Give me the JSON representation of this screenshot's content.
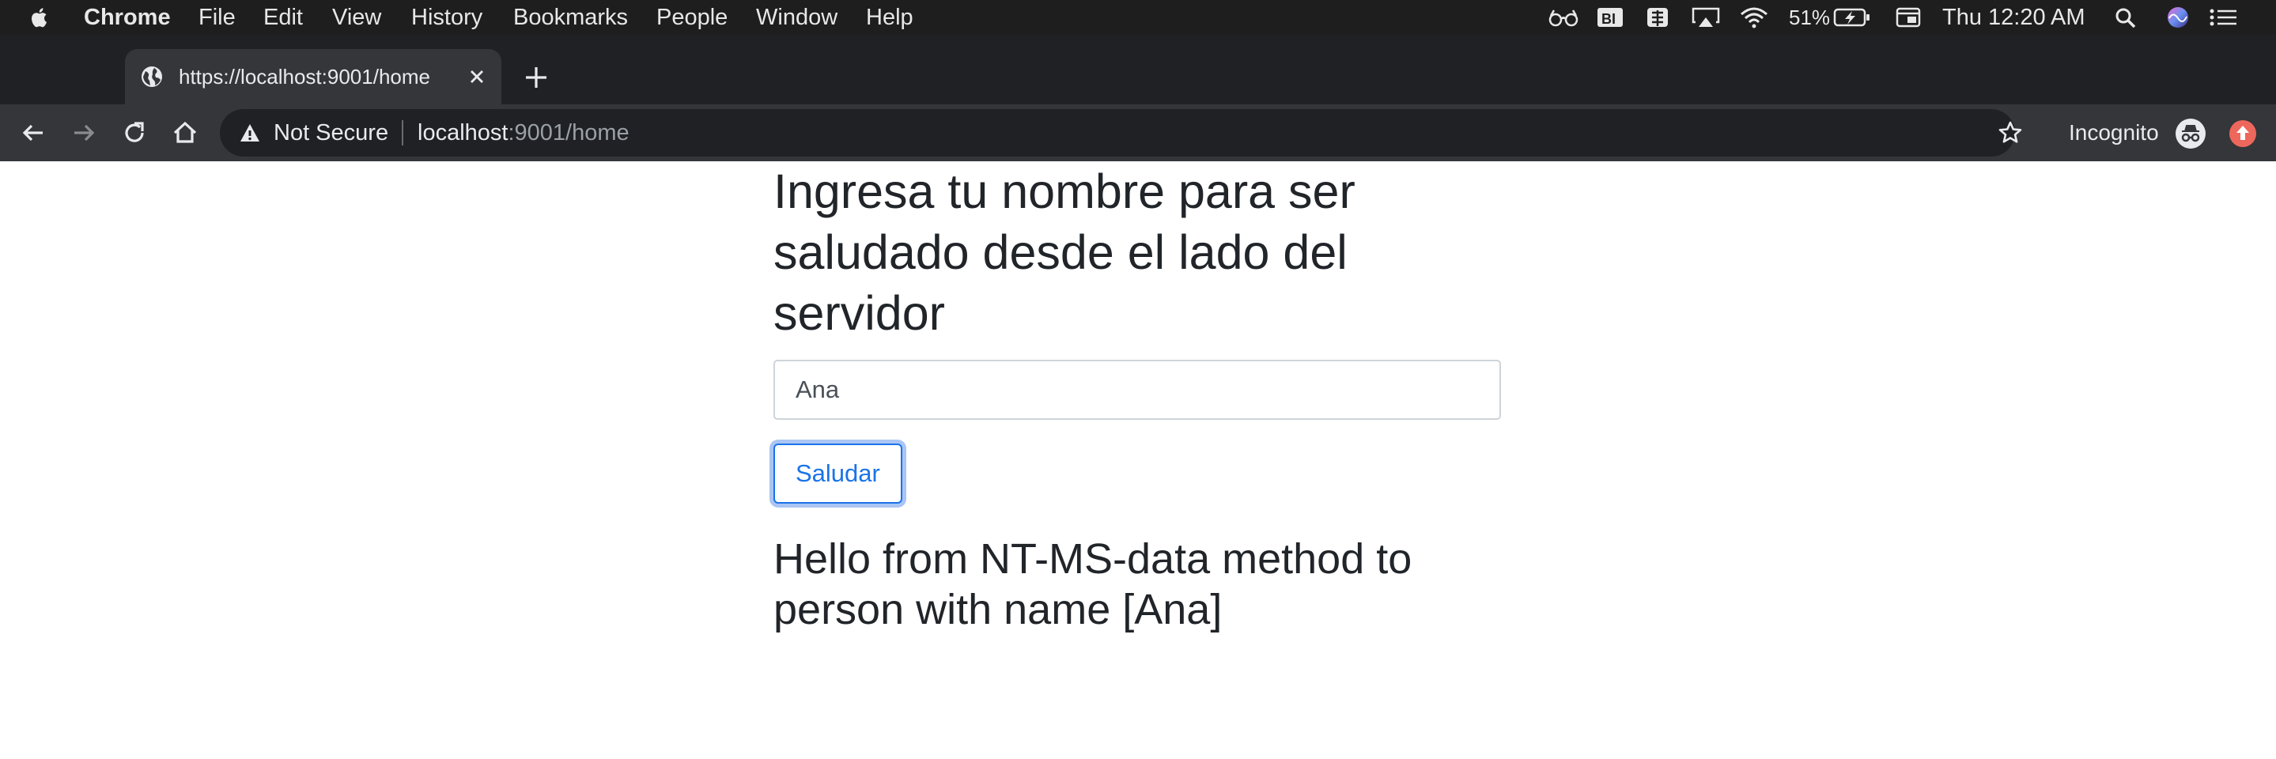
{
  "menubar": {
    "apple_icon": "apple-icon",
    "app_name": "Chrome",
    "menus": [
      "File",
      "Edit",
      "View",
      "History",
      "Bookmarks",
      "People",
      "Window",
      "Help"
    ],
    "status": {
      "battery_percent": "51%",
      "datetime": "Thu 12:20 AM",
      "icons": [
        "glasses-icon",
        "bi-icon",
        "keyboard-layout-icon",
        "airplay-icon",
        "wifi-icon",
        "battery-charging-icon",
        "display-icon",
        "spotlight-search-icon",
        "siri-icon",
        "notification-center-icon"
      ]
    }
  },
  "browser": {
    "tab": {
      "title": "https://localhost:9001/home",
      "favicon": "globe-icon"
    },
    "toolbar": {
      "security_label": "Not Secure",
      "url_host": "localhost",
      "url_rest": ":9001/home",
      "profile_label": "Incognito"
    }
  },
  "page": {
    "heading": "Ingresa tu nombre para ser saludado desde el lado del servidor",
    "input_value": "Ana",
    "button_label": "Saludar",
    "greeting": "Hello from NT-MS-data method to person with name [Ana]"
  },
  "colors": {
    "menubar_bg": "#1e1e1f",
    "tabstrip_bg": "#202124",
    "toolbar_bg": "#35363a",
    "accent": "#1a73e8",
    "text": "#212529"
  }
}
